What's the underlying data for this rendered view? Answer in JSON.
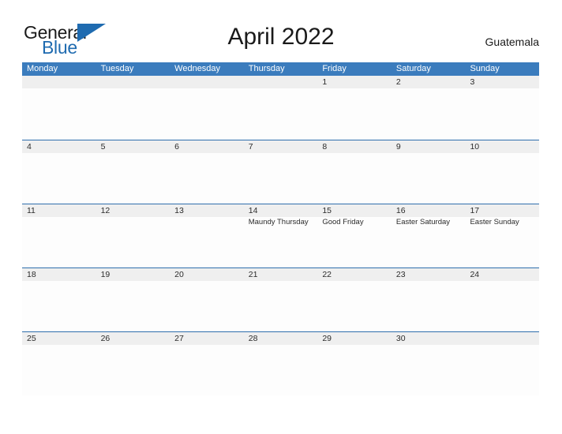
{
  "brand": {
    "name_part1": "General",
    "name_part2": "Blue",
    "flag_icon": "triangle-flag-icon",
    "color_primary": "#1f6bb0",
    "color_text": "#1a1a1a"
  },
  "header": {
    "title": "April 2022",
    "country": "Guatemala"
  },
  "calendar": {
    "accent_header_color": "#3b7cbd",
    "row_separator_color": "#2f6fad",
    "date_band_color": "#efefef",
    "weekdays": [
      "Monday",
      "Tuesday",
      "Wednesday",
      "Thursday",
      "Friday",
      "Saturday",
      "Sunday"
    ],
    "weeks": [
      [
        {
          "date": "",
          "event": ""
        },
        {
          "date": "",
          "event": ""
        },
        {
          "date": "",
          "event": ""
        },
        {
          "date": "",
          "event": ""
        },
        {
          "date": "1",
          "event": ""
        },
        {
          "date": "2",
          "event": ""
        },
        {
          "date": "3",
          "event": ""
        }
      ],
      [
        {
          "date": "4",
          "event": ""
        },
        {
          "date": "5",
          "event": ""
        },
        {
          "date": "6",
          "event": ""
        },
        {
          "date": "7",
          "event": ""
        },
        {
          "date": "8",
          "event": ""
        },
        {
          "date": "9",
          "event": ""
        },
        {
          "date": "10",
          "event": ""
        }
      ],
      [
        {
          "date": "11",
          "event": ""
        },
        {
          "date": "12",
          "event": ""
        },
        {
          "date": "13",
          "event": ""
        },
        {
          "date": "14",
          "event": "Maundy Thursday"
        },
        {
          "date": "15",
          "event": "Good Friday"
        },
        {
          "date": "16",
          "event": "Easter Saturday"
        },
        {
          "date": "17",
          "event": "Easter Sunday"
        }
      ],
      [
        {
          "date": "18",
          "event": ""
        },
        {
          "date": "19",
          "event": ""
        },
        {
          "date": "20",
          "event": ""
        },
        {
          "date": "21",
          "event": ""
        },
        {
          "date": "22",
          "event": ""
        },
        {
          "date": "23",
          "event": ""
        },
        {
          "date": "24",
          "event": ""
        }
      ],
      [
        {
          "date": "25",
          "event": ""
        },
        {
          "date": "26",
          "event": ""
        },
        {
          "date": "27",
          "event": ""
        },
        {
          "date": "28",
          "event": ""
        },
        {
          "date": "29",
          "event": ""
        },
        {
          "date": "30",
          "event": ""
        },
        {
          "date": "",
          "event": ""
        }
      ]
    ]
  }
}
